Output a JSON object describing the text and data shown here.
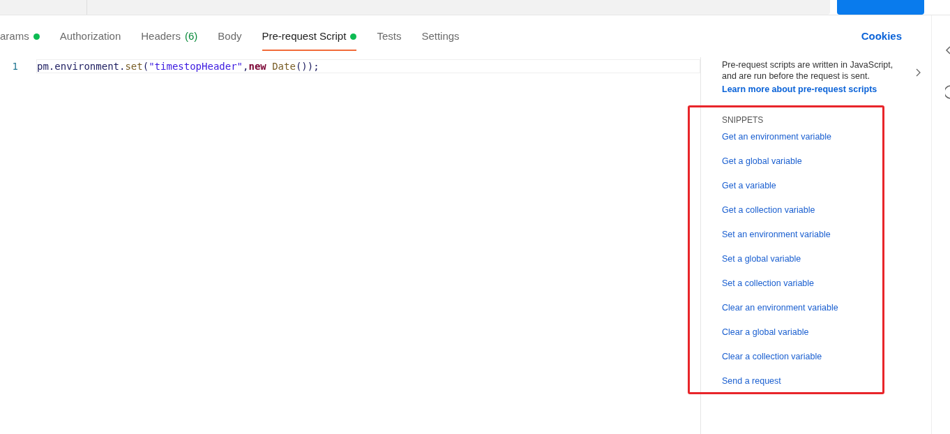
{
  "tabs": [
    {
      "label": "arams",
      "dot": true,
      "selected": false
    },
    {
      "label": "Authorization",
      "dot": false,
      "selected": false
    },
    {
      "label": "Headers",
      "dot": false,
      "count": "(6)",
      "selected": false
    },
    {
      "label": "Body",
      "dot": false,
      "selected": false
    },
    {
      "label": "Pre-request Script",
      "dot": true,
      "selected": true
    },
    {
      "label": "Tests",
      "dot": false,
      "selected": false
    },
    {
      "label": "Settings",
      "dot": false,
      "selected": false
    }
  ],
  "cookies_link": "Cookies",
  "editor": {
    "lines": [
      {
        "number": "1",
        "tokens": [
          {
            "text": "pm.environment.",
            "kind": "plain"
          },
          {
            "text": "set",
            "kind": "method"
          },
          {
            "text": "(",
            "kind": "plain"
          },
          {
            "text": "\"timestopHeader\"",
            "kind": "string"
          },
          {
            "text": ",",
            "kind": "plain"
          },
          {
            "text": "new ",
            "kind": "keyword"
          },
          {
            "text": "Date",
            "kind": "method"
          },
          {
            "text": "());",
            "kind": "plain"
          }
        ]
      }
    ]
  },
  "help": {
    "text": "Pre-request scripts are written in JavaScript, and are run before the request is sent.",
    "link": "Learn more about pre-request scripts"
  },
  "snippets": {
    "heading": "SNIPPETS",
    "highlighted": true,
    "items": [
      "Get an environment variable",
      "Get a global variable",
      "Get a variable",
      "Get a collection variable",
      "Set an environment variable",
      "Set a global variable",
      "Set a collection variable",
      "Clear an environment variable",
      "Clear a global variable",
      "Clear a collection variable",
      "Send a request"
    ]
  }
}
